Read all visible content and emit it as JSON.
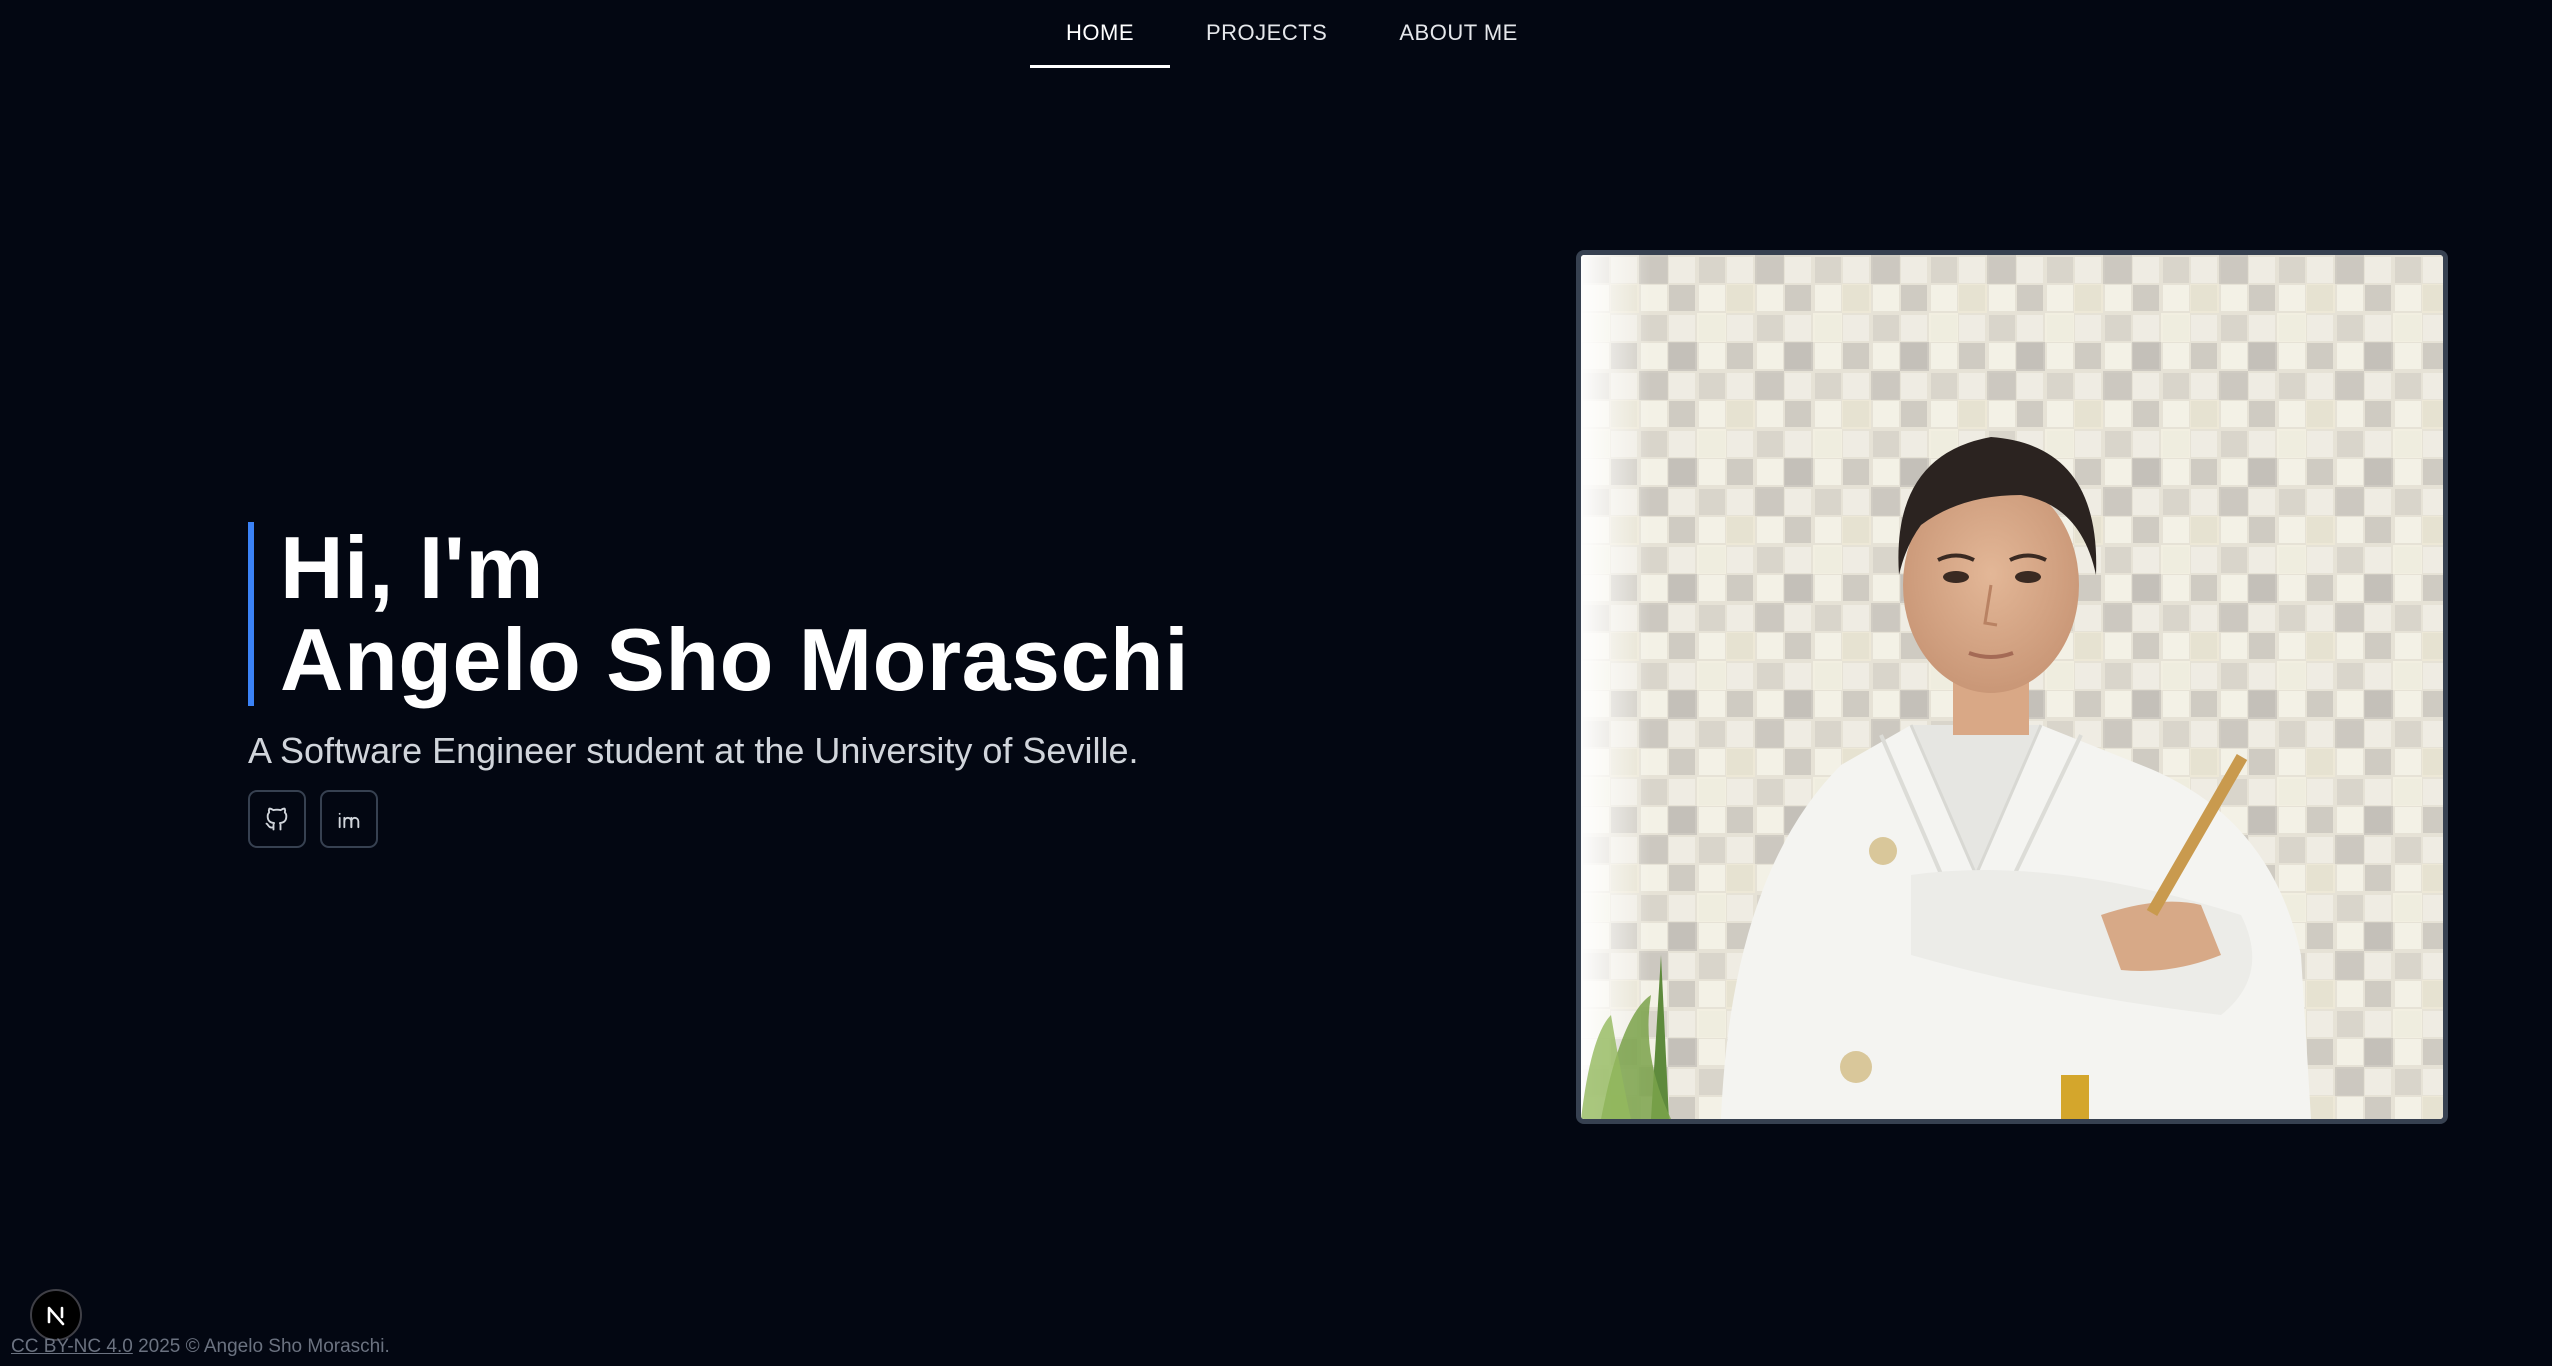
{
  "nav": {
    "items": [
      {
        "label": "HOME",
        "active": true
      },
      {
        "label": "PROJECTS",
        "active": false
      },
      {
        "label": "ABOUT ME",
        "active": false
      }
    ]
  },
  "hero": {
    "greeting": "Hi, I'm",
    "name": "Angelo Sho Moraschi",
    "subtitle": "A Software Engineer student at the University of Seville.",
    "social": [
      {
        "icon": "github-icon"
      },
      {
        "icon": "linkedin-icon"
      }
    ],
    "accent_color": "#3b82f6"
  },
  "portrait": {
    "alt": "Angelo Sho Moraschi"
  },
  "footer": {
    "license": "CC BY-NC 4.0",
    "text": " 2025 © Angelo Sho Moraschi."
  },
  "dev_badge": {
    "letter": "N",
    "icon": "nextjs-icon"
  },
  "colors": {
    "background": "#030712",
    "text": "#ffffff",
    "muted": "#d1d5db",
    "border": "#374151"
  }
}
